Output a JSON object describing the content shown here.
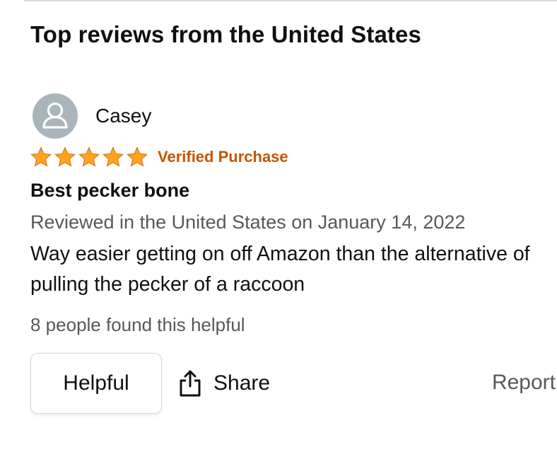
{
  "section": {
    "title": "Top reviews from the United States"
  },
  "review": {
    "reviewer_name": "Casey",
    "avatar_icon": "user-silhouette-icon",
    "rating": 5,
    "rating_max": 5,
    "star_color": "#ffa41c",
    "verified_label": "Verified Purchase",
    "verified_color": "#c45500",
    "title": "Best pecker bone",
    "date_text": "Reviewed in the United States on January 14, 2022",
    "body": "Way easier getting on off Amazon than the alternative of pulling the pecker of a raccoon",
    "helpful_count_text": "8 people found this helpful"
  },
  "actions": {
    "helpful_label": "Helpful",
    "share_label": "Share",
    "share_icon": "share-upload-icon",
    "report_label": "Report"
  }
}
